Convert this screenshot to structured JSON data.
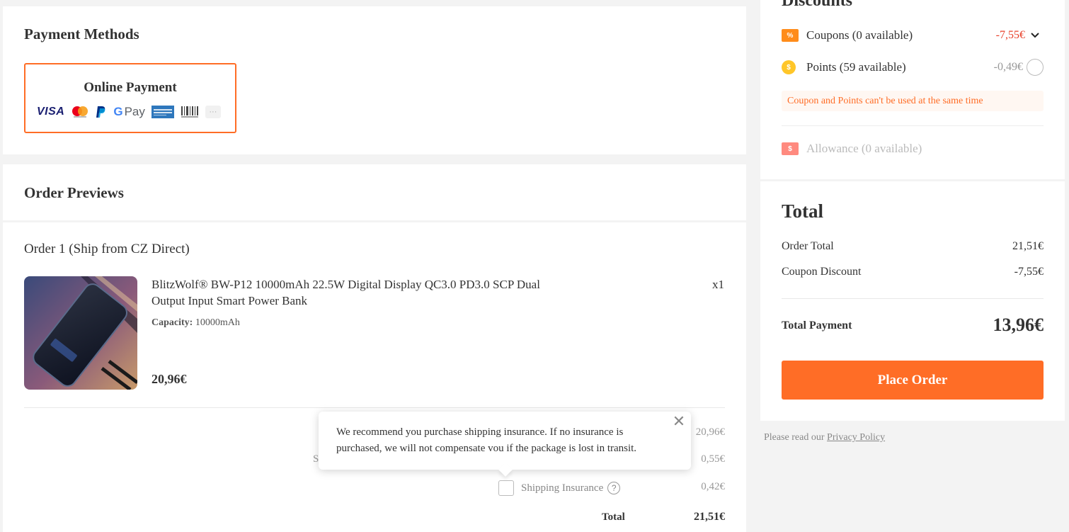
{
  "payment": {
    "title": "Payment Methods",
    "option_label": "Online Payment",
    "logos": {
      "visa": "VISA",
      "gpay_g": "G",
      "gpay": "Pay",
      "more": "···"
    }
  },
  "previews": {
    "title": "Order Previews"
  },
  "order": {
    "heading": "Order 1 (Ship from CZ Direct)",
    "product_name": "BlitzWolf® BW-P12 10000mAh 22.5W Digital Display QC3.0 PD3.0 SCP Dual Output Input Smart Power Bank",
    "quantity": "x1",
    "capacity_label": "Capacity:",
    "capacity_value": "10000mAh",
    "price": "20,96€",
    "subtotal": "20,96€",
    "shipping_label_partial": "S",
    "shipping": "0,55€",
    "insurance_label": "Shipping Insurance",
    "insurance_help": "?",
    "insurance": "0,42€",
    "total_label": "Total",
    "total": "21,51€"
  },
  "tooltip": {
    "text": "We recommend you purchase shipping insurance. If no insurance is purchased, we will not compensate vou if the package is lost in transit.",
    "close": "✕"
  },
  "discounts": {
    "title": "Discounts",
    "coupon_icon": "%",
    "coupon_label": "Coupons (0 available)",
    "coupon_value": "-7,55€",
    "points_icon": "$",
    "points_label": "Points (59 available)",
    "points_value": "-0,49€",
    "warning": "Coupon and Points can't be used at the same time",
    "allowance_icon": "$",
    "allowance_label": "Allowance (0 available)"
  },
  "totals": {
    "title": "Total",
    "order_total_label": "Order Total",
    "order_total": "21,51€",
    "coupon_discount_label": "Coupon Discount",
    "coupon_discount": "-7,55€",
    "total_payment_label": "Total Payment",
    "total_payment": "13,96€",
    "place_order": "Place Order"
  },
  "footer": {
    "privacy_prefix": "Please read our ",
    "privacy_link": "Privacy Policy"
  },
  "colors": {
    "accent": "#ff6d26",
    "coupon_red": "#e8402a"
  }
}
